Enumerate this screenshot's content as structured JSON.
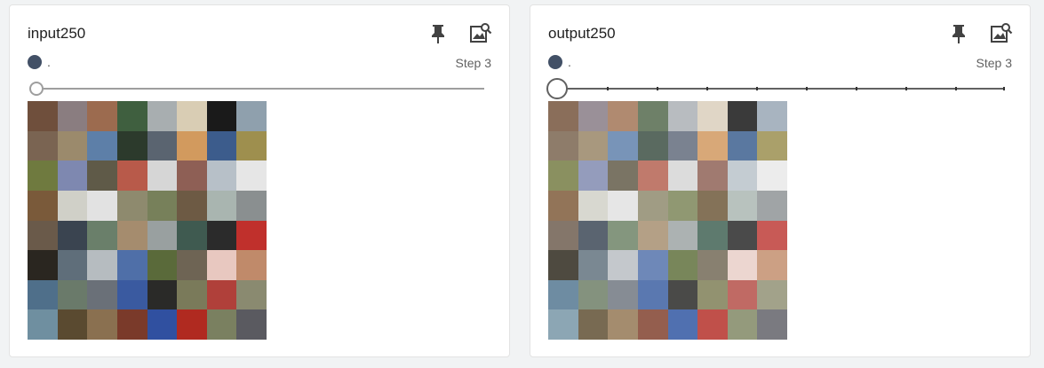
{
  "cards": [
    {
      "title": "input250",
      "run_label": ".",
      "step_label": "Step 3",
      "pin_icon": "pin-icon",
      "image_search_icon": "image-search-icon",
      "grid_colors": [
        [
          "#6f4f3c",
          "#8a7d80",
          "#9c6b4f",
          "#3f5f3f",
          "#a8aeb0",
          "#d9cdb4",
          "#1a1a1a",
          "#8fa0ad"
        ],
        [
          "#7a6452",
          "#9b8a6c",
          "#5d7fa8",
          "#2c3a2c",
          "#5a6470",
          "#d29a5e",
          "#3c5c8c",
          "#9e8f4e"
        ],
        [
          "#6f7a3f",
          "#7e88b0",
          "#5f5a48",
          "#b85a4a",
          "#d6d6d6",
          "#8e5f55",
          "#b7c0c8",
          "#e6e6e6"
        ],
        [
          "#7a5a3a",
          "#d0d0c8",
          "#e2e2e2",
          "#8e8a6e",
          "#77805a",
          "#6d5a44",
          "#a9b5b0",
          "#8a8f90"
        ],
        [
          "#6a5a4a",
          "#3a4450",
          "#6a7f6a",
          "#a58c6e",
          "#99a0a0",
          "#3f5a50",
          "#2b2b2b",
          "#c0302c"
        ],
        [
          "#2a2620",
          "#5f6e7a",
          "#b6bcc0",
          "#4f6fa8",
          "#5a6a3a",
          "#6e6454",
          "#e8c8c0",
          "#c08a6a"
        ],
        [
          "#4f6f8a",
          "#6a7a6a",
          "#6a7078",
          "#3a5aa0",
          "#2a2a28",
          "#7a7a5a",
          "#b0403a",
          "#8a8a70"
        ],
        [
          "#6f8fa0",
          "#5a4a30",
          "#8a7050",
          "#7a3a2a",
          "#3050a0",
          "#b02a20",
          "#7a8060",
          "#5a5a60"
        ]
      ]
    },
    {
      "title": "output250",
      "run_label": ".",
      "step_label": "Step 3",
      "pin_icon": "pin-icon",
      "image_search_icon": "image-search-icon",
      "grid_colors": [
        [
          "#8a6e5a",
          "#9a9098",
          "#b08a70",
          "#6e8068",
          "#b8bcc0",
          "#e0d6c6",
          "#3a3a3a",
          "#a8b4c0"
        ],
        [
          "#8e7c6a",
          "#a8987e",
          "#7894b8",
          "#5a6a60",
          "#7a8290",
          "#d8a878",
          "#5a78a0",
          "#aaa06a"
        ],
        [
          "#8a9060",
          "#949cbc",
          "#7a7464",
          "#c07a6c",
          "#dcdcdc",
          "#a07a70",
          "#c4ccd2",
          "#ececec"
        ],
        [
          "#927458",
          "#d8d8d0",
          "#e6e6e6",
          "#a09c84",
          "#909872",
          "#847258",
          "#b8c2be",
          "#a0a4a6"
        ],
        [
          "#84766a",
          "#5a6470",
          "#84967e",
          "#b4a086",
          "#acb2b2",
          "#5e7a6e",
          "#4a4a4a",
          "#c85a56"
        ],
        [
          "#4e4a40",
          "#7a8892",
          "#c4c8cc",
          "#6e88b8",
          "#78865a",
          "#888070",
          "#ecd6d0",
          "#cca084"
        ],
        [
          "#6e8ca2",
          "#84927e",
          "#868c94",
          "#5a78b0",
          "#4a4a48",
          "#929270",
          "#c06a64",
          "#a2a28a"
        ],
        [
          "#8ca6b4",
          "#786a52",
          "#a48c6e",
          "#945e4e",
          "#5070b0",
          "#c0504a",
          "#949a7c",
          "#7a7a80"
        ]
      ]
    }
  ]
}
